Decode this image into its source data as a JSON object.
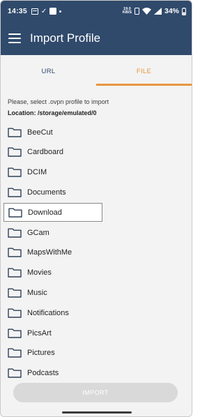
{
  "status_bar": {
    "time": "14:35",
    "speed_value": "19.0",
    "speed_unit": "KB/S",
    "battery": "34%"
  },
  "app_bar": {
    "title": "Import Profile"
  },
  "tabs": [
    {
      "label": "URL",
      "selected": false
    },
    {
      "label": "FILE",
      "selected": true
    }
  ],
  "content": {
    "hint": "Please, select .ovpn profile to import",
    "location": "Location: /storage/emulated/0"
  },
  "folders": [
    {
      "name": "BeeCut"
    },
    {
      "name": "Cardboard"
    },
    {
      "name": "DCIM"
    },
    {
      "name": "Documents"
    },
    {
      "name": "Download",
      "selected": true
    },
    {
      "name": "GCam"
    },
    {
      "name": "MapsWithMe"
    },
    {
      "name": "Movies"
    },
    {
      "name": "Music"
    },
    {
      "name": "Notifications"
    },
    {
      "name": "PicsArt"
    },
    {
      "name": "Pictures"
    },
    {
      "name": "Podcasts"
    }
  ],
  "import_button": {
    "label": "IMPORT",
    "enabled": false
  },
  "colors": {
    "primary": "#304a6c",
    "accent": "#e8963f",
    "background": "#f3f3f3",
    "button_disabled": "#d9d9d9"
  }
}
